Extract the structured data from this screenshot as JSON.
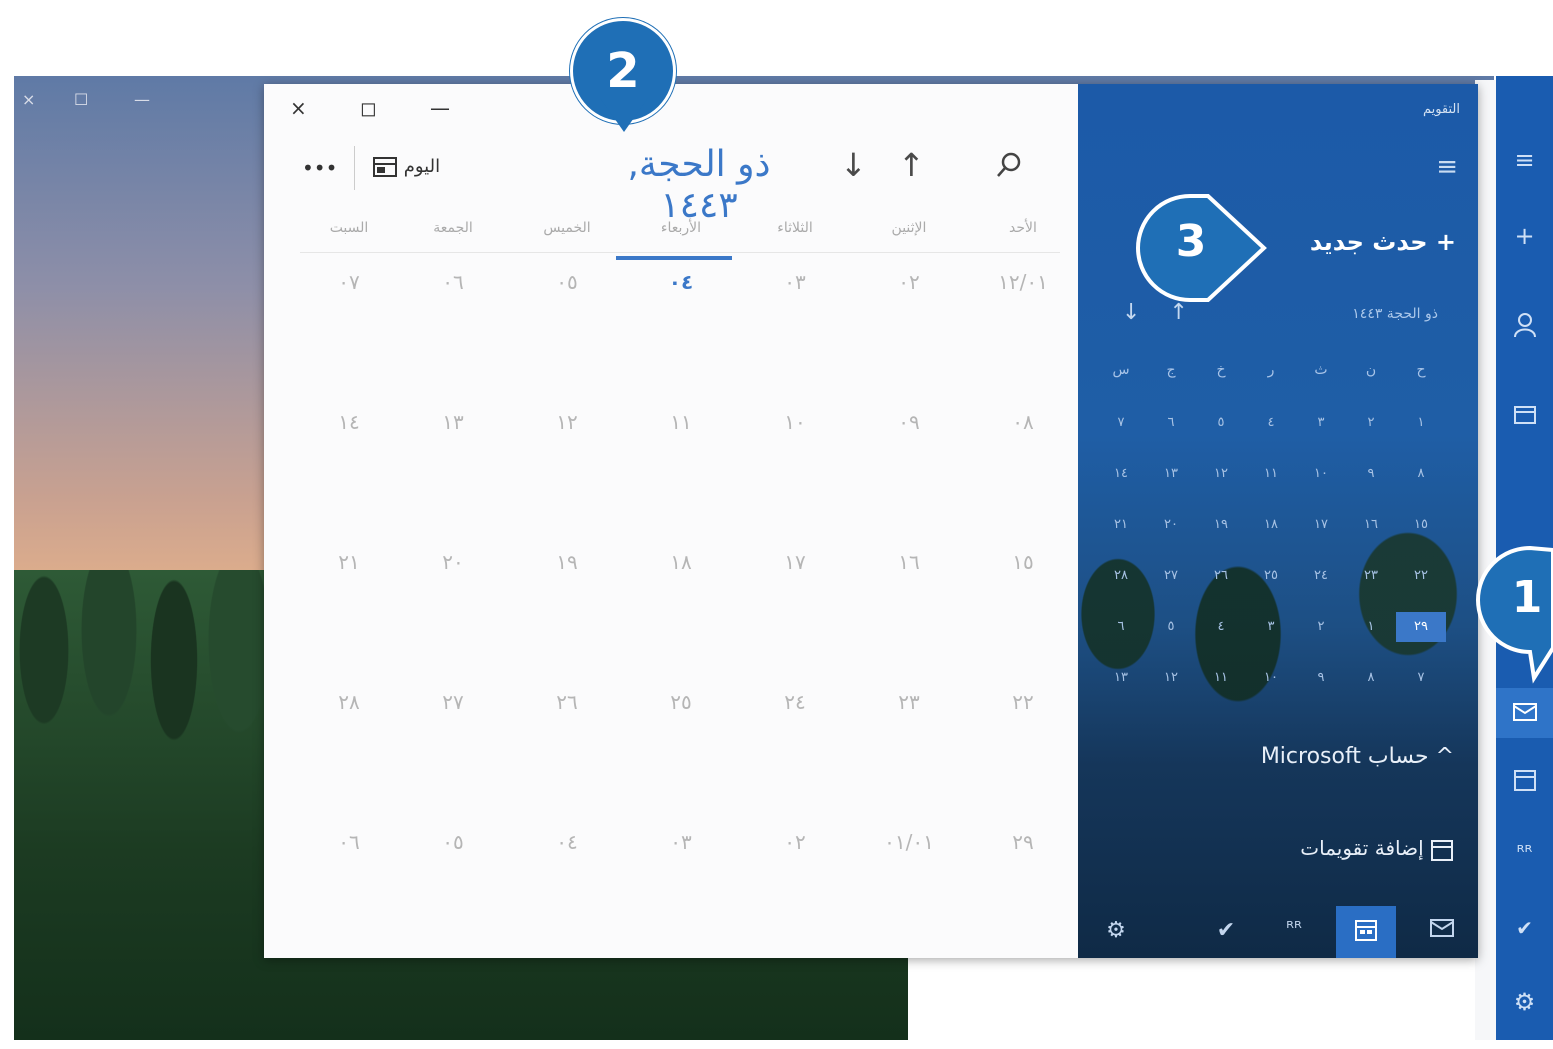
{
  "desktop": {
    "controls": [
      "×",
      "☐",
      "—"
    ]
  },
  "window": {
    "close": "×",
    "maximize": "◻",
    "minimize": "—"
  },
  "toolbar": {
    "search_icon": "search-icon",
    "up_arrow": "↑",
    "down_arrow": "↓",
    "month_title": "ذو الحجة, ١٤٤٣",
    "today_label": "اليوم",
    "today_icon": "calendar-today-icon",
    "more": "•••"
  },
  "weekdays": [
    "الأحد",
    "الإثنين",
    "الثلاثاء",
    "الأربعاء",
    "الخميس",
    "الجمعة",
    "السبت"
  ],
  "weeks": [
    [
      "١٢/٠١",
      "٠٢",
      "٠٣",
      "٠٤",
      "٠٥",
      "٠٦",
      "٠٧"
    ],
    [
      "٠٨",
      "٠٩",
      "١٠",
      "١١",
      "١٢",
      "١٣",
      "١٤"
    ],
    [
      "١٥",
      "١٦",
      "١٧",
      "١٨",
      "١٩",
      "٢٠",
      "٢١"
    ],
    [
      "٢٢",
      "٢٣",
      "٢٤",
      "٢٥",
      "٢٦",
      "٢٧",
      "٢٨"
    ],
    [
      "٢٩",
      "٠١/٠١",
      "٠٢",
      "٠٣",
      "٠٤",
      "٠٥",
      "٠٦"
    ]
  ],
  "today_index": {
    "week": 0,
    "day": 3
  },
  "side": {
    "title": "التقويم",
    "menu_icon": "≡",
    "new_event": "+ حدث جديد",
    "mini_month": "ذو الحجة ١٤٤٣",
    "mini_up": "↑",
    "mini_down": "↓",
    "mini_heads": [
      "ح",
      "ن",
      "ث",
      "ر",
      "خ",
      "ج",
      "س"
    ],
    "mini_weeks": [
      [
        "١",
        "٢",
        "٣",
        "٤",
        "٥",
        "٦",
        "٧"
      ],
      [
        "٨",
        "٩",
        "١٠",
        "١١",
        "١٢",
        "١٣",
        "١٤"
      ],
      [
        "١٥",
        "١٦",
        "١٧",
        "١٨",
        "١٩",
        "٢٠",
        "٢١"
      ],
      [
        "٢٢",
        "٢٣",
        "٢٤",
        "٢٥",
        "٢٦",
        "٢٧",
        "٢٨"
      ],
      [
        "٢٩",
        "١",
        "٢",
        "٣",
        "٤",
        "٥",
        "٦"
      ],
      [
        "٧",
        "٨",
        "٩",
        "١٠",
        "١١",
        "١٢",
        "١٣"
      ]
    ],
    "account": "^ حساب Microsoft",
    "add_calendars": "إضافة تقويمات",
    "bottom_icons": [
      "mail-icon",
      "calendar-icon",
      "people-icon",
      "todo-icon",
      "settings-icon"
    ]
  },
  "right_strip": {
    "icons": [
      "menu-icon",
      "add-icon",
      "person-icon",
      "folder-icon",
      "mail-icon",
      "calendar-icon",
      "people-icon",
      "todo-icon",
      "settings-icon"
    ]
  },
  "callouts": [
    "1",
    "2",
    "3"
  ],
  "colors": {
    "accent": "#3b78c8",
    "side_blue": "#1c5aa8",
    "callout": "#1f6fb6"
  }
}
